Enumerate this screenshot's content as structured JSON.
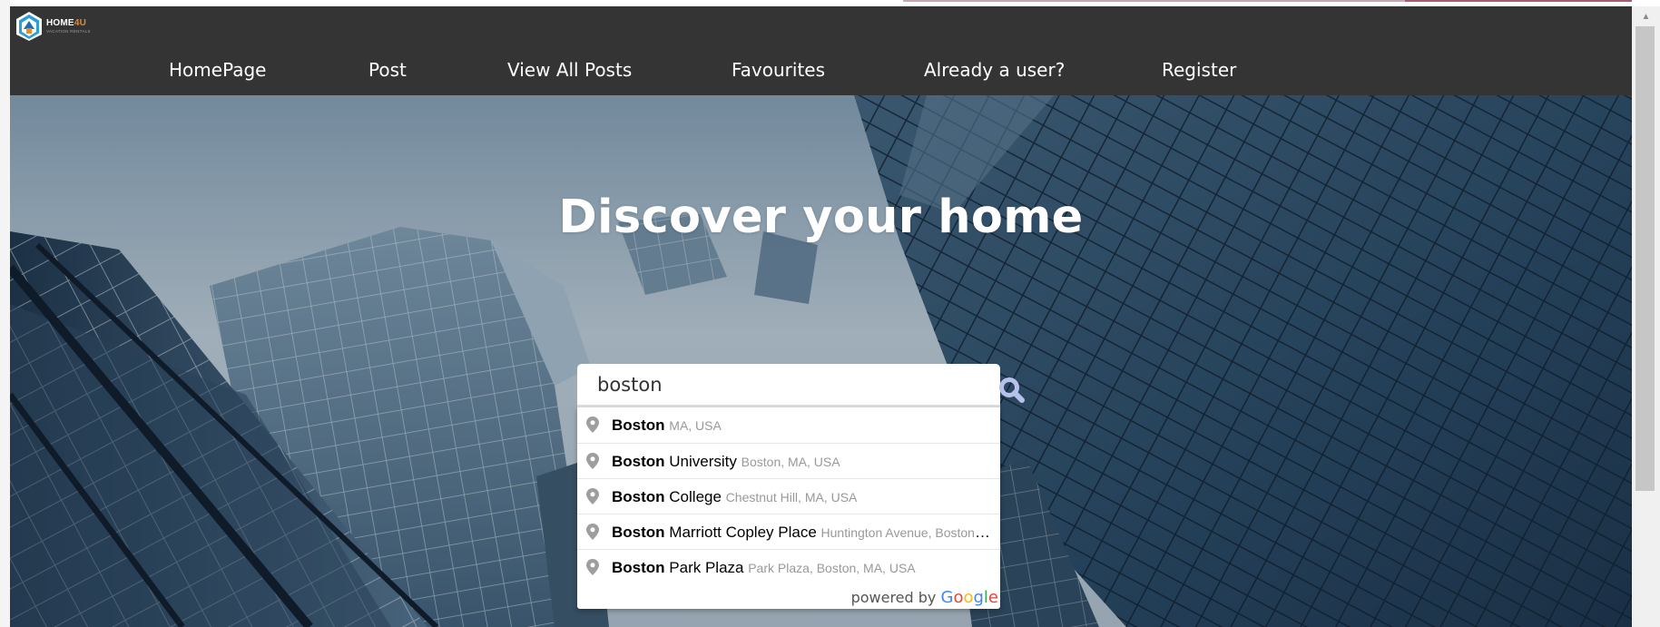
{
  "brand": {
    "name_main": "HOME",
    "name_accent": "4U",
    "tagline": "VACATION RENTALS"
  },
  "nav": {
    "items": [
      {
        "label": "HomePage"
      },
      {
        "label": "Post"
      },
      {
        "label": "View All Posts"
      },
      {
        "label": "Favourites"
      },
      {
        "label": "Already a user?"
      },
      {
        "label": "Register"
      }
    ]
  },
  "hero": {
    "title": "Discover your home"
  },
  "search": {
    "value": "boston",
    "icon": "search-icon"
  },
  "autocomplete": {
    "items": [
      {
        "match": "Boston",
        "rest": "",
        "secondary": "MA, USA"
      },
      {
        "match": "Boston",
        "rest": "University",
        "secondary": "Boston, MA, USA"
      },
      {
        "match": "Boston",
        "rest": "College",
        "secondary": "Chestnut Hill, MA, USA"
      },
      {
        "match": "Boston",
        "rest": "Marriott Copley Place",
        "secondary": "Huntington Avenue, Boston, MA, USA"
      },
      {
        "match": "Boston",
        "rest": "Park Plaza",
        "secondary": "Park Plaza, Boston, MA, USA"
      }
    ],
    "powered_by": "powered by",
    "google": "Google"
  },
  "colors": {
    "navbar": "#343434",
    "accent": "#e88a2c",
    "hero_text": "#ffffff",
    "secondary_text": "#999999"
  }
}
